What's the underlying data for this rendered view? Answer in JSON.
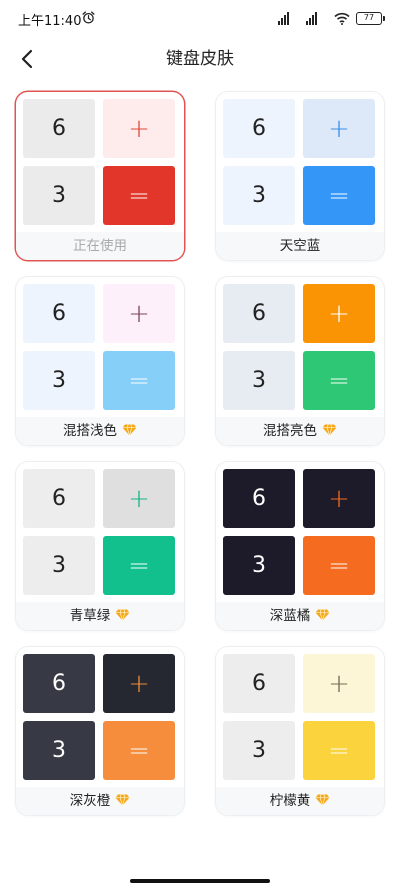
{
  "status_bar": {
    "time": "上午11:40",
    "battery": "77"
  },
  "header": {
    "title": "键盘皮肤"
  },
  "skins": [
    {
      "name": "正在使用",
      "premium": false,
      "selected": true,
      "colors": {
        "num_bg": "#ebebeb",
        "num_fg": "#222222",
        "plus_bg": "#fdeceb",
        "plus_fg": "#e0463a",
        "eq_bg": "#e2362a",
        "eq_fg": "#ffffff"
      }
    },
    {
      "name": "天空蓝",
      "premium": false,
      "selected": false,
      "colors": {
        "num_bg": "#eef4fd",
        "num_fg": "#222222",
        "plus_bg": "#dde9f9",
        "plus_fg": "#3a8ee6",
        "eq_bg": "#3497f7",
        "eq_fg": "#ffffff"
      }
    },
    {
      "name": "混搭浅色",
      "premium": true,
      "selected": false,
      "colors": {
        "num_bg": "#eef4fd",
        "num_fg": "#222222",
        "plus_bg": "#fdf0fb",
        "plus_fg": "#7a4560",
        "eq_bg": "#86cff8",
        "eq_fg": "#ffffff"
      }
    },
    {
      "name": "混搭亮色",
      "premium": true,
      "selected": false,
      "colors": {
        "num_bg": "#e7ecf3",
        "num_fg": "#222222",
        "plus_bg": "#fb9405",
        "plus_fg": "#ffffff",
        "eq_bg": "#2ec775",
        "eq_fg": "#ffffff"
      }
    },
    {
      "name": "青草绿",
      "premium": true,
      "selected": false,
      "colors": {
        "num_bg": "#ededed",
        "num_fg": "#222222",
        "plus_bg": "#dfdfdf",
        "plus_fg": "#12b585",
        "eq_bg": "#12c08d",
        "eq_fg": "#ffffff"
      }
    },
    {
      "name": "深蓝橘",
      "premium": true,
      "selected": false,
      "colors": {
        "num_bg": "#1d1a2a",
        "num_fg": "#ffffff",
        "plus_bg": "#1d1a2a",
        "plus_fg": "#f26a22",
        "eq_bg": "#f56b20",
        "eq_fg": "#ffffff"
      }
    },
    {
      "name": "深灰橙",
      "premium": true,
      "selected": false,
      "colors": {
        "num_bg": "#373a44",
        "num_fg": "#ffffff",
        "plus_bg": "#252830",
        "plus_fg": "#f08a3a",
        "eq_bg": "#f58d3d",
        "eq_fg": "#ffffff"
      }
    },
    {
      "name": "柠檬黄",
      "premium": true,
      "selected": false,
      "colors": {
        "num_bg": "#ededed",
        "num_fg": "#222222",
        "plus_bg": "#fdf6d6",
        "plus_fg": "#6e6a52",
        "eq_bg": "#fbd33c",
        "eq_fg": "#ffffff"
      }
    }
  ],
  "keys": {
    "num1": "6",
    "num2": "3",
    "plus": "+",
    "equals": "="
  },
  "icons": {
    "back": "chevron-left-icon",
    "premium": "diamond-icon",
    "alarm": "alarm-clock-icon",
    "signal": "signal-icon",
    "wifi": "wifi-icon",
    "battery": "battery-icon"
  },
  "accent": {
    "selected_border": "#e25454",
    "diamond": "#f6a81a"
  }
}
